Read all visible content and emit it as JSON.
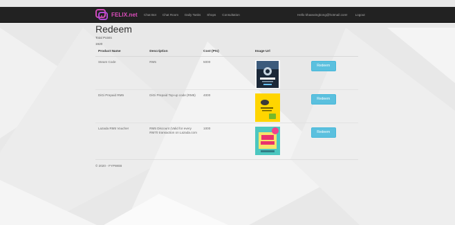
{
  "colors": {
    "navbar": "#222222",
    "brand": "#e04fbf",
    "accent": "#5bc0de"
  },
  "brand": {
    "name": "FELIX.net",
    "icon": "felix-logo-icon"
  },
  "nav": {
    "items": [
      "Chat Bot",
      "Chat Room",
      "Daily Tasks",
      "Shops",
      "Consultation"
    ]
  },
  "user": {
    "greeting": "Hello khawwingkong@hotmail.com!",
    "logout": "Logout"
  },
  "page": {
    "title": "Redeem",
    "points_label": "Total Points",
    "points_value": "1920"
  },
  "table": {
    "headers": [
      "Product Name",
      "Description",
      "Cost (Pts)",
      "Image Url"
    ],
    "rows": [
      {
        "name": "Steam Code",
        "description": "RM5",
        "cost": "5000",
        "image": "steam-card-image",
        "button": "Redeem"
      },
      {
        "name": "DiGi Prepaid RM5",
        "description": "DiGi Prepaid Top-up code (RM5)",
        "cost": "4000",
        "image": "digi-card-image",
        "button": "Redeem"
      },
      {
        "name": "Lazada RM5 Voucher",
        "description": "RM5 Discount (Valid for every RM70 transaction on Lazada.com",
        "cost": "1000",
        "image": "lazada-voucher-image",
        "button": "Redeem"
      }
    ]
  },
  "footer": {
    "text": "© 2020 - FYPWEB"
  }
}
